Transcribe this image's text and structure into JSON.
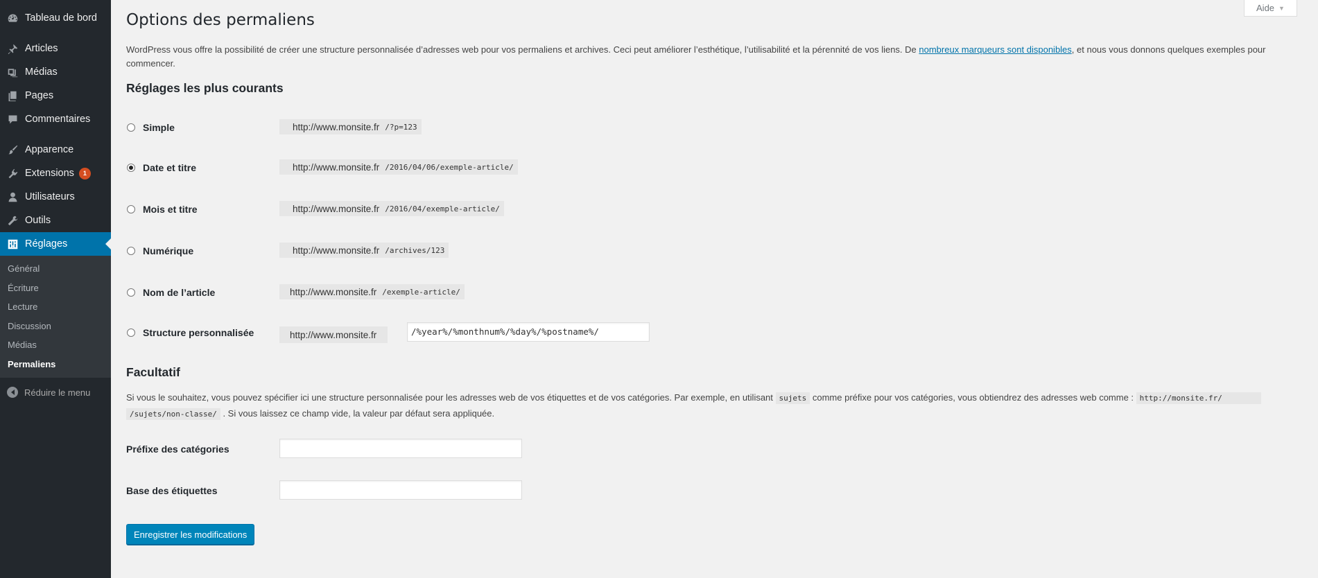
{
  "sidebar": {
    "top": [
      {
        "label": "Tableau de bord",
        "icon": "dashboard-icon"
      }
    ],
    "main": [
      {
        "label": "Articles",
        "icon": "pin-icon"
      },
      {
        "label": "Médias",
        "icon": "media-icon"
      },
      {
        "label": "Pages",
        "icon": "pages-icon"
      },
      {
        "label": "Commentaires",
        "icon": "comment-icon"
      }
    ],
    "admin": [
      {
        "label": "Apparence",
        "icon": "brush-icon"
      },
      {
        "label": "Extensions",
        "icon": "plugin-icon",
        "badge": "1"
      },
      {
        "label": "Utilisateurs",
        "icon": "user-icon"
      },
      {
        "label": "Outils",
        "icon": "wrench-icon"
      },
      {
        "label": "Réglages",
        "icon": "settings-icon",
        "active": true
      }
    ],
    "submenu": [
      "Général",
      "Écriture",
      "Lecture",
      "Discussion",
      "Médias",
      "Permaliens"
    ],
    "submenu_current": "Permaliens",
    "collapse_label": "Réduire le menu"
  },
  "help_tab": {
    "label": "Aide",
    "arrow": "▼"
  },
  "page": {
    "title": "Options des permaliens",
    "intro_before": "WordPress vous offre la possibilité de créer une structure personnalisée d’adresses web pour vos permaliens et archives. Ceci peut améliorer l’esthétique, l’utilisabilité et la pérennité de vos liens. De ",
    "intro_link": "nombreux marqueurs sont disponibles",
    "intro_after": ", et nous vous donnons quelques exemples pour commencer.",
    "common_heading": "Réglages les plus courants",
    "options": [
      {
        "label": "Simple",
        "base": "http://www.monsite.fr",
        "path": "/?p=123",
        "checked": false
      },
      {
        "label": "Date et titre",
        "base": "http://www.monsite.fr",
        "path": "/2016/04/06/exemple-article/",
        "checked": true
      },
      {
        "label": "Mois et titre",
        "base": "http://www.monsite.fr",
        "path": "/2016/04/exemple-article/",
        "checked": false
      },
      {
        "label": "Numérique",
        "base": "http://www.monsite.fr",
        "path": "/archives/123",
        "checked": false
      },
      {
        "label": "Nom de l’article",
        "base": "http://www.monsite.fr",
        "path": "/exemple-article/",
        "checked": false
      }
    ],
    "custom": {
      "label": "Structure personnalisée",
      "base": "http://www.monsite.fr",
      "value": "/%year%/%monthnum%/%day%/%postname%/"
    },
    "optional_heading": "Facultatif",
    "optional_text_1": "Si vous le souhaitez, vous pouvez spécifier ici une structure personnalisée pour les adresses web de vos étiquettes et de vos catégories. Par exemple, en utilisant ",
    "optional_code_1": "sujets",
    "optional_text_2": " comme préfixe pour vos catégories, vous obtiendrez des adresses web comme : ",
    "optional_code_2": "http://monsite.fr/",
    "optional_code_3": "/sujets/non-classe/",
    "optional_text_3": " . Si vous laissez ce champ vide, la valeur par défaut sera appliquée.",
    "category_base_label": "Préfixe des catégories",
    "category_base_value": "",
    "tag_base_label": "Base des étiquettes",
    "tag_base_value": "",
    "save_label": "Enregistrer les modifications"
  }
}
